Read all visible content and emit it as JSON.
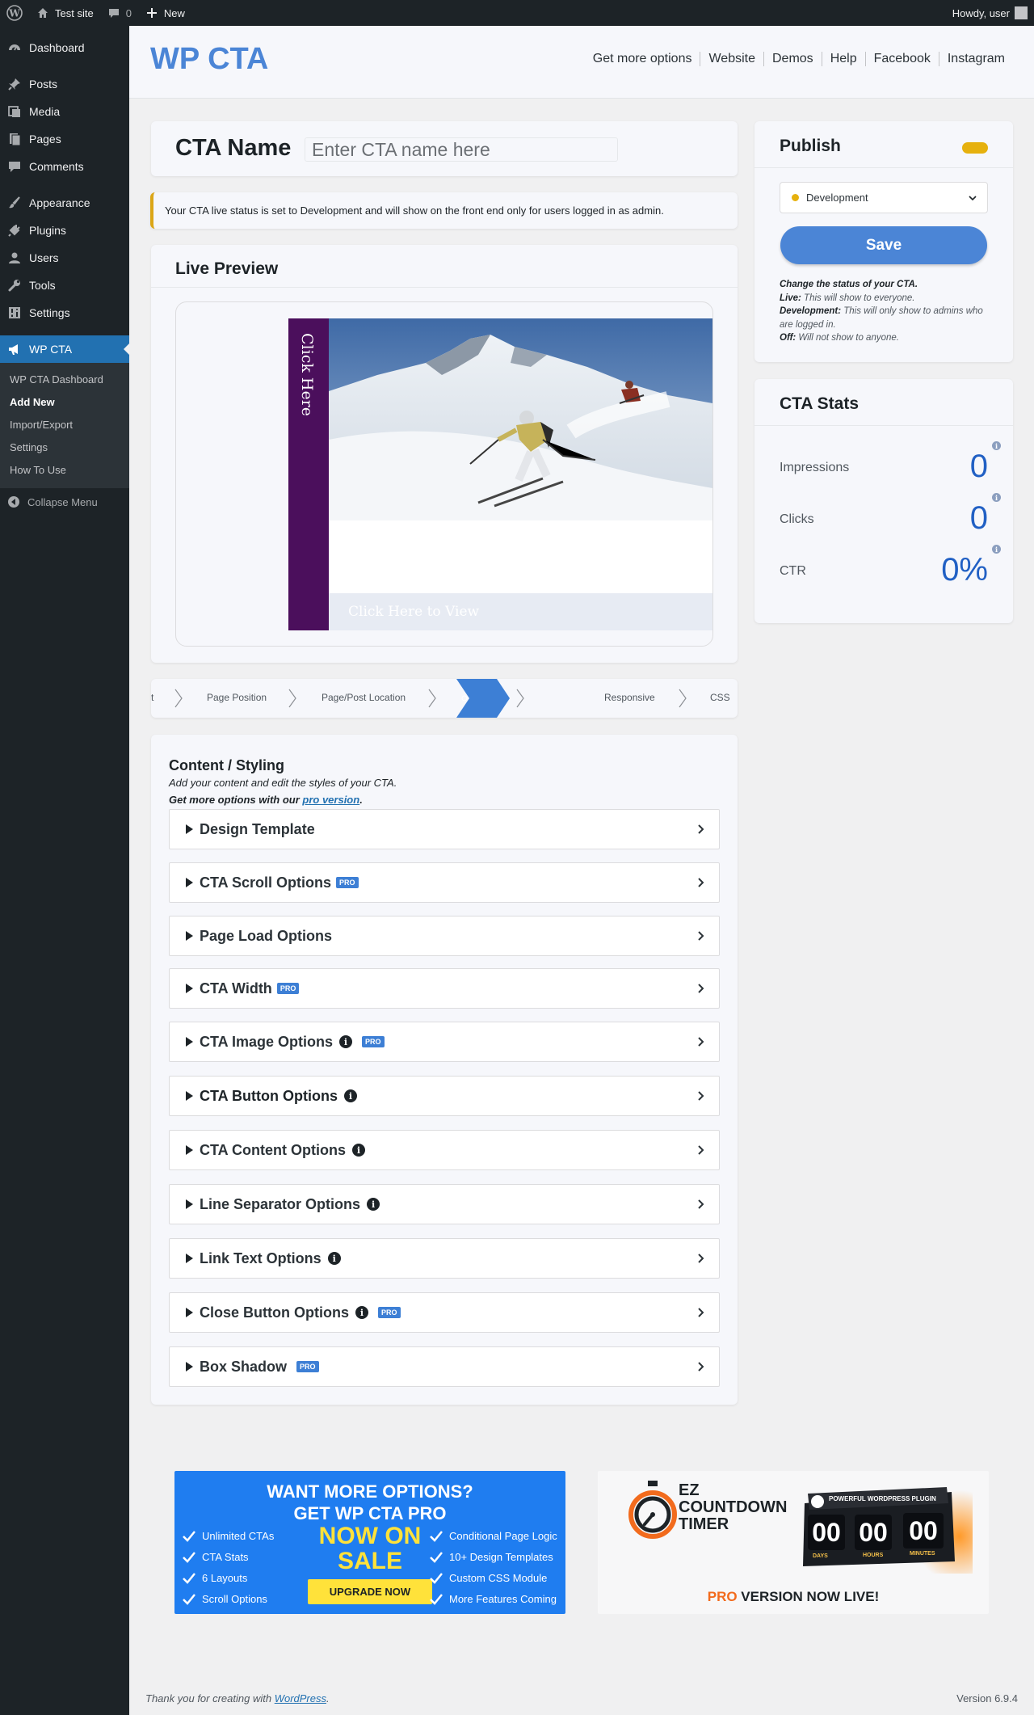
{
  "adminbar": {
    "site_name": "Test site",
    "comments_count": "0",
    "new_label": "New",
    "howdy": "Howdy, user"
  },
  "sidebar": {
    "items": [
      {
        "label": "Dashboard",
        "icon": "dashboard-icon"
      },
      {
        "label": "Posts",
        "icon": "pin-icon"
      },
      {
        "label": "Media",
        "icon": "media-icon"
      },
      {
        "label": "Pages",
        "icon": "pages-icon"
      },
      {
        "label": "Comments",
        "icon": "comment-icon"
      },
      {
        "label": "Appearance",
        "icon": "brush-icon"
      },
      {
        "label": "Plugins",
        "icon": "plug-icon"
      },
      {
        "label": "Users",
        "icon": "user-icon"
      },
      {
        "label": "Tools",
        "icon": "wrench-icon"
      },
      {
        "label": "Settings",
        "icon": "settings-icon"
      },
      {
        "label": "WP CTA",
        "icon": "megaphone-icon"
      }
    ],
    "submenu": [
      "WP CTA Dashboard",
      "Add New",
      "Import/Export",
      "Settings",
      "How To Use"
    ],
    "collapse_label": "Collapse Menu"
  },
  "header": {
    "logo": "WP CTA",
    "nav": [
      "Get more options",
      "Website",
      "Demos",
      "Help",
      "Facebook",
      "Instagram"
    ]
  },
  "title_card": {
    "label": "CTA Name",
    "placeholder": "Enter CTA name here"
  },
  "notice": "Your CTA live status is set to Development and will show on the front end only for users logged in as admin.",
  "preview": {
    "title": "Live Preview",
    "tab_label": "Click Here",
    "link_text": "Click Here to View",
    "tab_color": "#4b0f5c"
  },
  "steps": {
    "labels": [
      "t",
      "Page Position",
      "Page/Post Location",
      "Responsive",
      "CSS"
    ]
  },
  "content": {
    "title": "Content / Styling",
    "subtitle": "Add your content and edit the styles of your CTA.",
    "pro_prefix": "Get more options with our ",
    "pro_link": "pro version",
    "pro_suffix": ".",
    "pro_badge": "PRO",
    "sections": [
      {
        "label": "Design Template",
        "info": false,
        "pro": false
      },
      {
        "label": "CTA Scroll Options",
        "info": false,
        "pro": true
      },
      {
        "label": "Page Load Options",
        "info": false,
        "pro": false
      },
      {
        "label": "CTA Width",
        "info": false,
        "pro": true
      },
      {
        "label": "CTA Image Options",
        "info": true,
        "pro": true
      },
      {
        "label": "CTA Button Options",
        "info": true,
        "pro": false
      },
      {
        "label": "CTA Content Options",
        "info": true,
        "pro": false
      },
      {
        "label": "Line Separator Options",
        "info": true,
        "pro": false
      },
      {
        "label": "Link Text Options",
        "info": true,
        "pro": false
      },
      {
        "label": "Close Button Options",
        "info": true,
        "pro": true
      },
      {
        "label": "Box Shadow",
        "info": false,
        "pro": true
      }
    ]
  },
  "publish": {
    "title": "Publish",
    "status_value": "Development",
    "save_label": "Save",
    "help_title": "Change the status of your CTA.",
    "help_live_label": "Live:",
    "help_live": " This will show to everyone.",
    "help_dev_label": "Development:",
    "help_dev": " This will only show to admins who are logged in.",
    "help_off_label": "Off:",
    "help_off": " Will not show to anyone.",
    "accent": "#e6b10e"
  },
  "stats": {
    "title": "CTA Stats",
    "rows": [
      {
        "label": "Impressions",
        "value": "0"
      },
      {
        "label": "Clicks",
        "value": "0"
      },
      {
        "label": "CTR",
        "value": "0%"
      }
    ]
  },
  "promo_pro": {
    "headline1": "WANT MORE OPTIONS?",
    "headline2": "GET WP CTA PRO",
    "left_features": [
      "Unlimited CTAs",
      "CTA Stats",
      "6 Layouts",
      "Scroll Options"
    ],
    "right_features": [
      "Conditional Page Logic",
      "10+ Design Templates",
      "Custom CSS Module",
      "More Features Coming"
    ],
    "sale_line1": "NOW ON",
    "sale_line2": "SALE",
    "button": "UPGRADE NOW"
  },
  "promo_ez": {
    "title_line1": "EZ",
    "title_line2": "COUNTDOWN",
    "title_line3": "TIMER",
    "banner": "POWERFUL WORDPRESS PLUGIN",
    "digits": [
      "00",
      "00",
      "00"
    ],
    "units": [
      "DAYS",
      "HOURS",
      "MINUTES"
    ],
    "footer_pro": "PRO",
    "footer_rest": " VERSION NOW LIVE!"
  },
  "footer": {
    "thanks_prefix": "Thank you for creating with ",
    "thanks_link": "WordPress",
    "thanks_suffix": ".",
    "version": "Version 6.9.4"
  }
}
